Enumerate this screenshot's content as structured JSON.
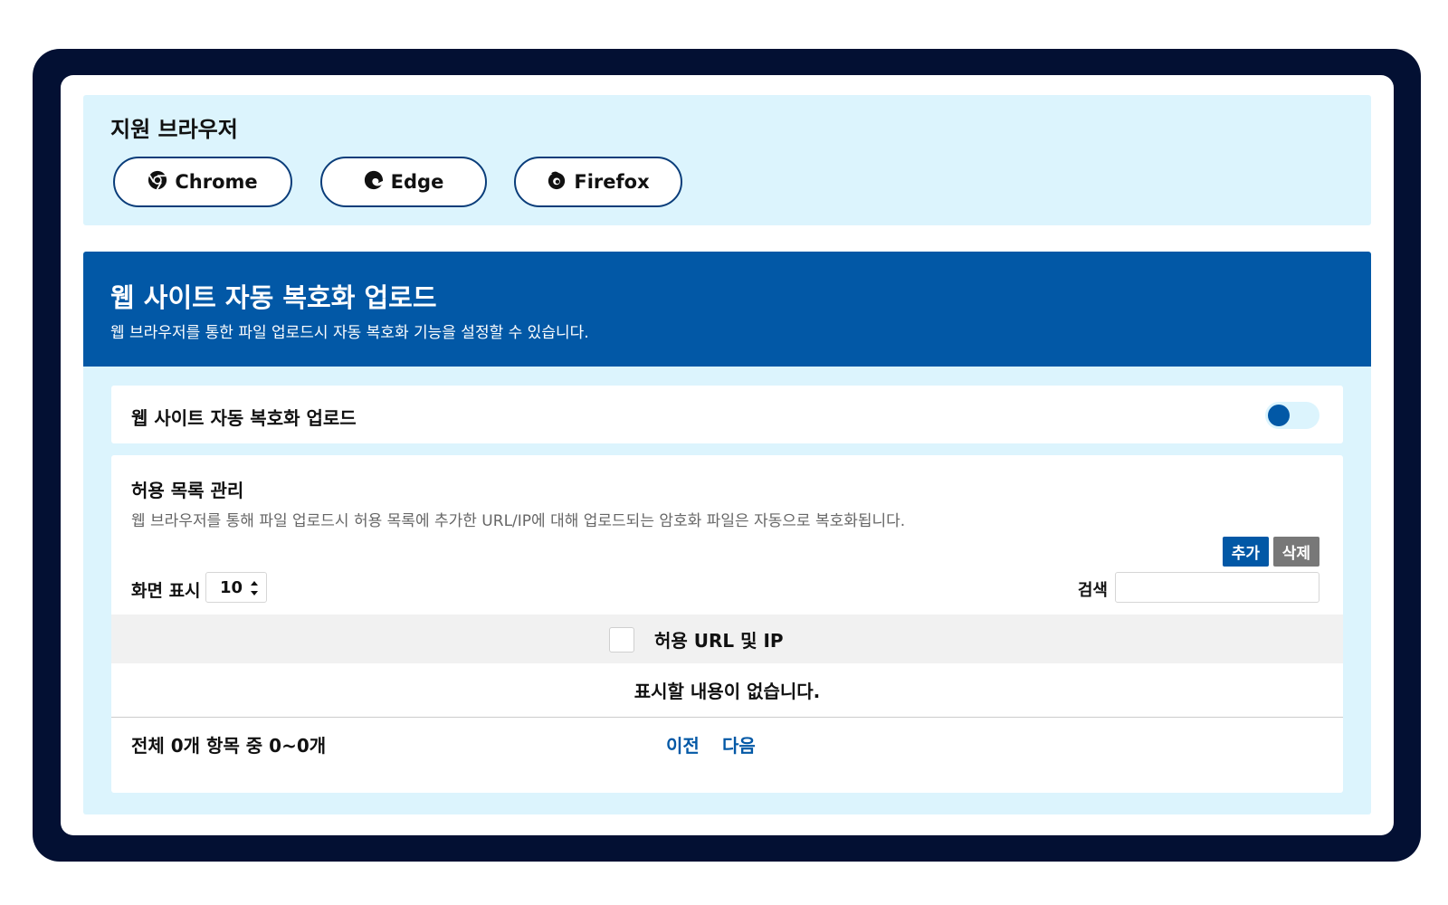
{
  "browsers": {
    "title": "지원 브라우저",
    "items": [
      {
        "label": "Chrome",
        "icon": "chrome-icon"
      },
      {
        "label": "Edge",
        "icon": "edge-icon"
      },
      {
        "label": "Firefox",
        "icon": "firefox-icon"
      }
    ]
  },
  "panel": {
    "title": "웹 사이트 자동 복호화 업로드",
    "subtitle": "웹 브라우저를 통한 파일 업로드시 자동 복호화 기능을 설정할 수 있습니다."
  },
  "toggle": {
    "label": "웹 사이트 자동 복호화 업로드",
    "state": "off"
  },
  "allowlist": {
    "title": "허용 목록 관리",
    "description": "웹 브라우저를 통해 파일 업로드시 허용 목록에 추가한 URL/IP에 대해 업로드되는 암호화 파일은 자동으로 복호화됩니다.",
    "add_label": "추가",
    "delete_label": "삭제",
    "per_page_label": "화면 표시",
    "per_page_value": "10",
    "search_label": "검색",
    "search_value": "",
    "column_header": "허용 URL 및 IP",
    "empty_message": "표시할 내용이 없습니다.",
    "summary": "전체 0개 항목 중 0~0개",
    "prev_label": "이전",
    "next_label": "다음"
  },
  "colors": {
    "frame": "#031033",
    "accent": "#0258a6",
    "panel_bg": "#dcf4fd",
    "delete_button": "#787878"
  }
}
